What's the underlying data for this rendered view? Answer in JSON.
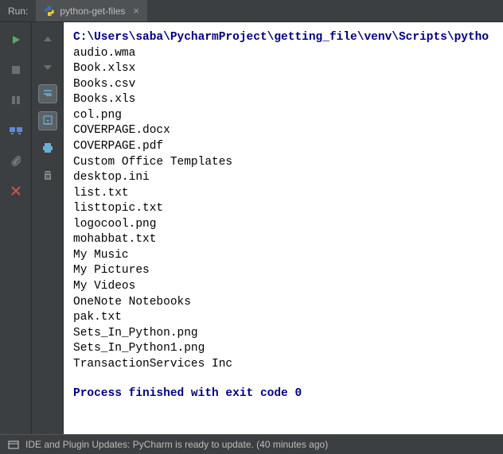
{
  "header": {
    "run_label": "Run:",
    "tab_label": "python-get-files",
    "tab_close": "×"
  },
  "console": {
    "command": "C:\\Users\\saba\\PycharmProject\\getting_file\\venv\\Scripts\\pytho",
    "lines": [
      "audio.wma",
      "Book.xlsx",
      "Books.csv",
      "Books.xls",
      "col.png",
      "COVERPAGE.docx",
      "COVERPAGE.pdf",
      "Custom Office Templates",
      "desktop.ini",
      "list.txt",
      "listtopic.txt",
      "logocool.png",
      "mohabbat.txt",
      "My Music",
      "My Pictures",
      "My Videos",
      "OneNote Notebooks",
      "pak.txt",
      "Sets_In_Python.png",
      "Sets_In_Python1.png",
      "TransactionServices Inc"
    ],
    "exit_message": "Process finished with exit code 0"
  },
  "status": {
    "text": "IDE and Plugin Updates: PyCharm is ready to update. (40 minutes ago)"
  }
}
